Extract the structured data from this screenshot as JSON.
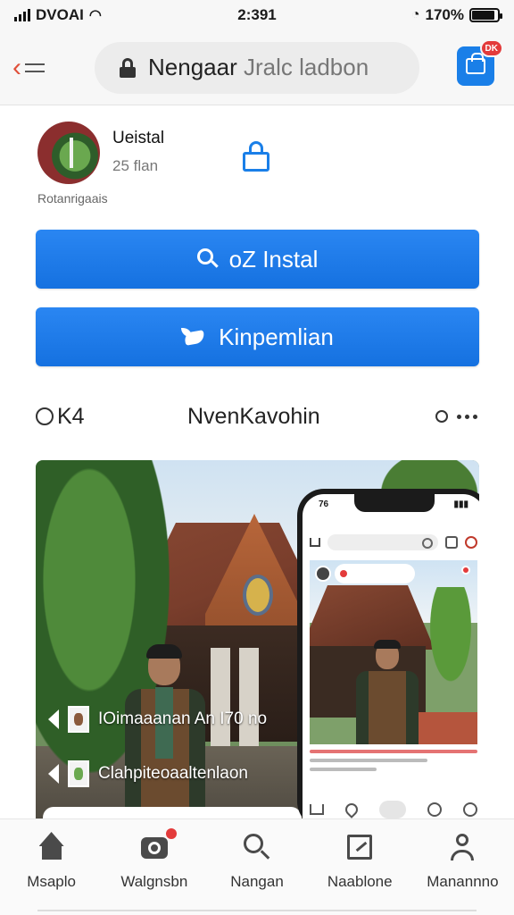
{
  "status_bar": {
    "carrier": "DVOAI",
    "time": "2:391",
    "battery": "170%",
    "battery_level": 0.9,
    "icons": [
      "signal-icon",
      "wifi-icon",
      "alarm-icon",
      "battery-icon"
    ]
  },
  "browser": {
    "url_host": "Nengaar",
    "url_path": "Jralc ladbon",
    "icons": [
      "back-icon",
      "menu-icon",
      "lock-icon",
      "app-icon"
    ],
    "app_badge": "DK"
  },
  "profile": {
    "name": "Ueistal",
    "sub": "25 flan",
    "caption": "Rotanrigaais",
    "icons": [
      "avatar",
      "share-icon"
    ]
  },
  "buttons": {
    "install": "oZ Instal",
    "share": "Kinpemlian"
  },
  "tabs": {
    "left": "K4",
    "center": "NvenKavohin"
  },
  "media": {
    "caption_1": "IOimaaanan An I70 no",
    "caption_2": "Clahpiteoaaltenlaon",
    "phone_time": "76"
  },
  "bottom_nav": [
    {
      "label": "Msaplo",
      "icon": "home-icon"
    },
    {
      "label": "Walgnsbn",
      "icon": "camera-icon"
    },
    {
      "label": "Nangan",
      "icon": "search-icon"
    },
    {
      "label": "Naablone",
      "icon": "document-icon"
    },
    {
      "label": "Manannno",
      "icon": "profile-icon"
    }
  ],
  "colors": {
    "accent": "#1a7fe8",
    "button": "#1571e0",
    "back_arrow": "#e0503a",
    "badge": "#e33b3b"
  }
}
